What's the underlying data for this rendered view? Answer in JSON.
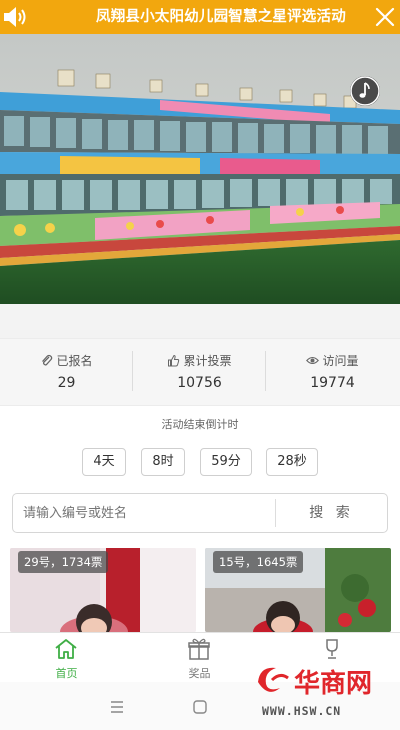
{
  "banner": {
    "title": "凤翔县小太阳幼儿园智慧之星评选活动",
    "speaker_icon": "speaker-icon",
    "close_icon": "close-icon",
    "color": "#f2a70e"
  },
  "hero": {
    "image": "kindergarten-building-photo",
    "music_icon": "music-note-icon"
  },
  "stats": [
    {
      "label": "已报名",
      "value": "29",
      "icon": "paperclip-icon"
    },
    {
      "label": "累计投票",
      "value": "10756",
      "icon": "thumbs-up-icon"
    },
    {
      "label": "访问量",
      "value": "19774",
      "icon": "eye-icon"
    }
  ],
  "countdown": {
    "title": "活动结束倒计时",
    "units": [
      "4天",
      "8时",
      "59分",
      "28秒"
    ]
  },
  "search": {
    "placeholder": "请输入编号或姓名",
    "button": "搜 索"
  },
  "cards": [
    {
      "tag": "29号，1734票"
    },
    {
      "tag": "15号，1645票"
    }
  ],
  "tabbar": {
    "items": [
      {
        "label": "首页",
        "icon": "home-icon",
        "active": true
      },
      {
        "label": "奖品",
        "icon": "gift-icon",
        "active": false
      },
      {
        "label": "",
        "icon": "trophy-icon",
        "active": false
      }
    ],
    "active_color": "#3fae45"
  },
  "watermark": {
    "logo": "华商网",
    "url": "WWW.HSW.CN"
  }
}
